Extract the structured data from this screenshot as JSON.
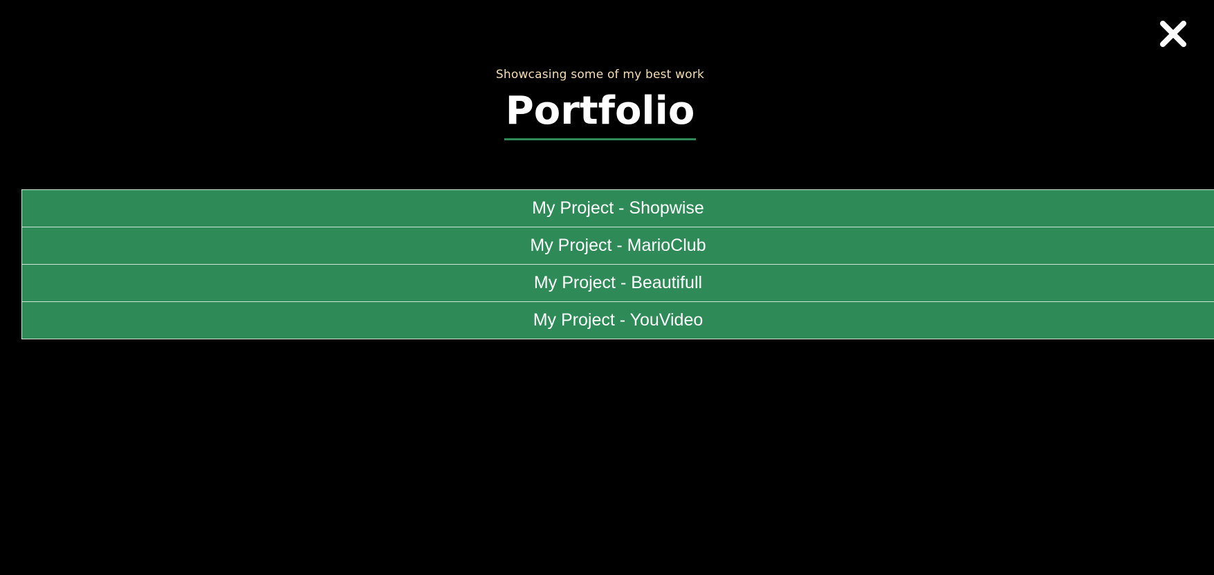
{
  "colors": {
    "background": "#000000",
    "accent": "#2e8b57",
    "subtitle": "#f5deb3",
    "text": "#ffffff"
  },
  "close": {
    "icon": "close-icon"
  },
  "header": {
    "subtitle": "Showcasing some of my best work",
    "title": "Portfolio"
  },
  "projects": [
    {
      "label": "My Project - Shopwise"
    },
    {
      "label": "My Project - MarioClub"
    },
    {
      "label": "My Project - Beautifull"
    },
    {
      "label": "My Project - YouVideo"
    }
  ]
}
